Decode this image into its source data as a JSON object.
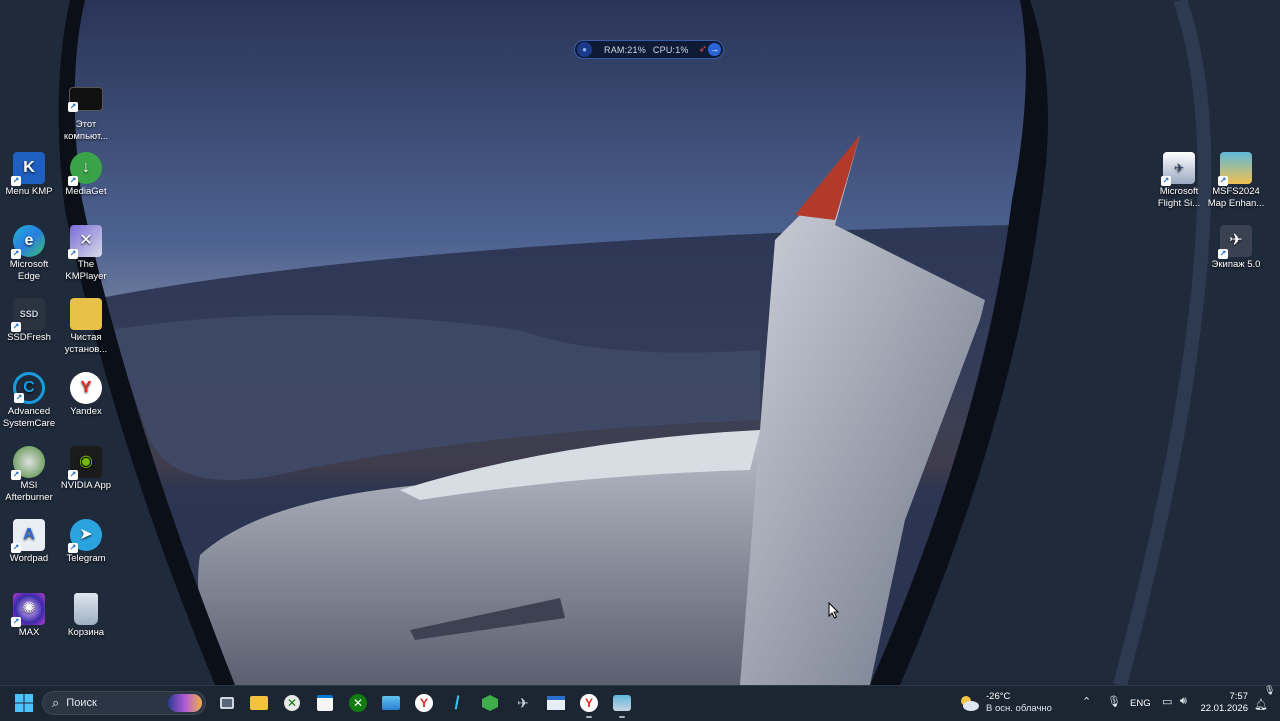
{
  "monitor": {
    "ram": "RAM:21%",
    "cpu": "CPU:1%"
  },
  "desktop_icons_left": [
    {
      "label": "Этот компьют...",
      "icon": "computer-icon"
    },
    {
      "label": "Menu KMP",
      "icon": "kmp-menu-icon"
    },
    {
      "label": "MediaGet",
      "icon": "mediaget-icon"
    },
    {
      "label": "Microsoft Edge",
      "icon": "edge-icon"
    },
    {
      "label": "The KMPlayer",
      "icon": "kmplayer-icon"
    },
    {
      "label": "SSDFresh",
      "icon": "ssdfresh-icon"
    },
    {
      "label": "Чистая установ...",
      "icon": "folder-icon"
    },
    {
      "label": "Advanced SystemCare",
      "icon": "advanced-systemcare-icon"
    },
    {
      "label": "Yandex",
      "icon": "yandex-icon"
    },
    {
      "label": "MSI Afterburner",
      "icon": "msi-afterburner-icon"
    },
    {
      "label": "NVIDIA App",
      "icon": "nvidia-icon"
    },
    {
      "label": "Wordpad",
      "icon": "wordpad-icon"
    },
    {
      "label": "Telegram",
      "icon": "telegram-icon"
    },
    {
      "label": "MAX",
      "icon": "max-icon"
    },
    {
      "label": "Корзина",
      "icon": "recycle-bin-icon"
    }
  ],
  "desktop_icons_right": [
    {
      "label": "Microsoft Flight Si...",
      "icon": "flight-simulator-icon"
    },
    {
      "label": "MSFS2024 Map Enhan...",
      "icon": "map-enhancement-icon"
    },
    {
      "label": "Экипаж 5.0",
      "icon": "ekipazh-icon"
    }
  ],
  "taskbar": {
    "search_placeholder": "Поиск",
    "weather_temp": "-26°C",
    "weather_desc": "В осн. облачно",
    "language": "ENG",
    "time": "7:57",
    "date": "22.01.2026"
  },
  "colors": {
    "taskbar": "#1c2633",
    "accent": "#0078d4"
  }
}
